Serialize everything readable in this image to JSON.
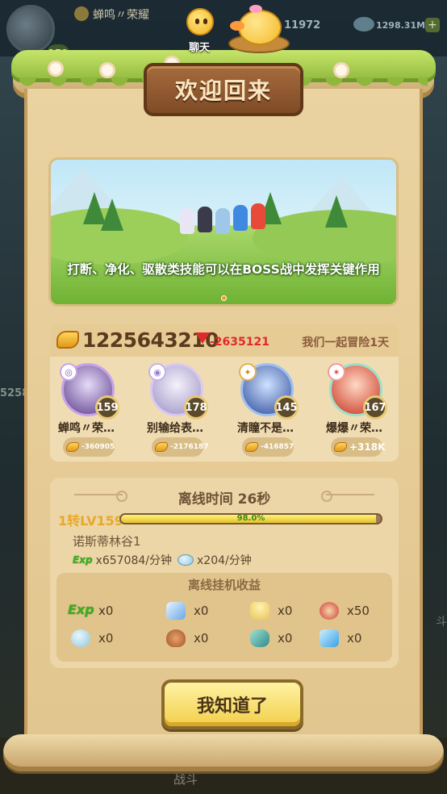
{
  "background": {
    "player_name": "蝉鸣〃荣耀",
    "player_level": "159",
    "power": "11972",
    "gems": "1298.31M",
    "plus": "+",
    "left_number": "5258",
    "bottom_tab": "战斗",
    "right_char": "斗"
  },
  "chat": {
    "label": "聊天"
  },
  "title": "欢迎回来",
  "banner": {
    "tip": "打断、净化、驱散类技能可以在BOSS战中发挥关键作用"
  },
  "team": {
    "total_power": "1225643210",
    "power_delta": "-2635121",
    "adventure_days": "我们一起冒险1天",
    "heroes": [
      {
        "name": "蝉鸣〃荣…",
        "level": "159",
        "power_change": "-360905"
      },
      {
        "name": "别输给表…",
        "level": "178",
        "power_change": "-2176187"
      },
      {
        "name": "清瞳不是…",
        "level": "145",
        "power_change": "-416857"
      },
      {
        "name": "爆爆〃荣…",
        "level": "167",
        "power_change": "+318K"
      }
    ]
  },
  "offline": {
    "time_label": "离线时间 26秒",
    "level_label": "1转LV159",
    "progress_percent": 98.0,
    "progress_text": "98.0%",
    "map_name": "诺斯蒂林谷1",
    "exp_rate": "x657084/分钟",
    "gem_rate": "x204/分钟",
    "exp_icon_text": "Exp",
    "rewards_title": "离线挂机收益",
    "rewards": [
      {
        "icon": "exp-icon",
        "count": "x0"
      },
      {
        "icon": "crystal-icon",
        "count": "x0"
      },
      {
        "icon": "candle-icon",
        "count": "x0"
      },
      {
        "icon": "medal-icon",
        "count": "x50"
      },
      {
        "icon": "gem-icon",
        "count": "x0"
      },
      {
        "icon": "meat-icon",
        "count": "x0"
      },
      {
        "icon": "leaf-stone-icon",
        "count": "x0"
      },
      {
        "icon": "ice-crystal-icon",
        "count": "x0"
      }
    ]
  },
  "confirm_button": "我知道了"
}
